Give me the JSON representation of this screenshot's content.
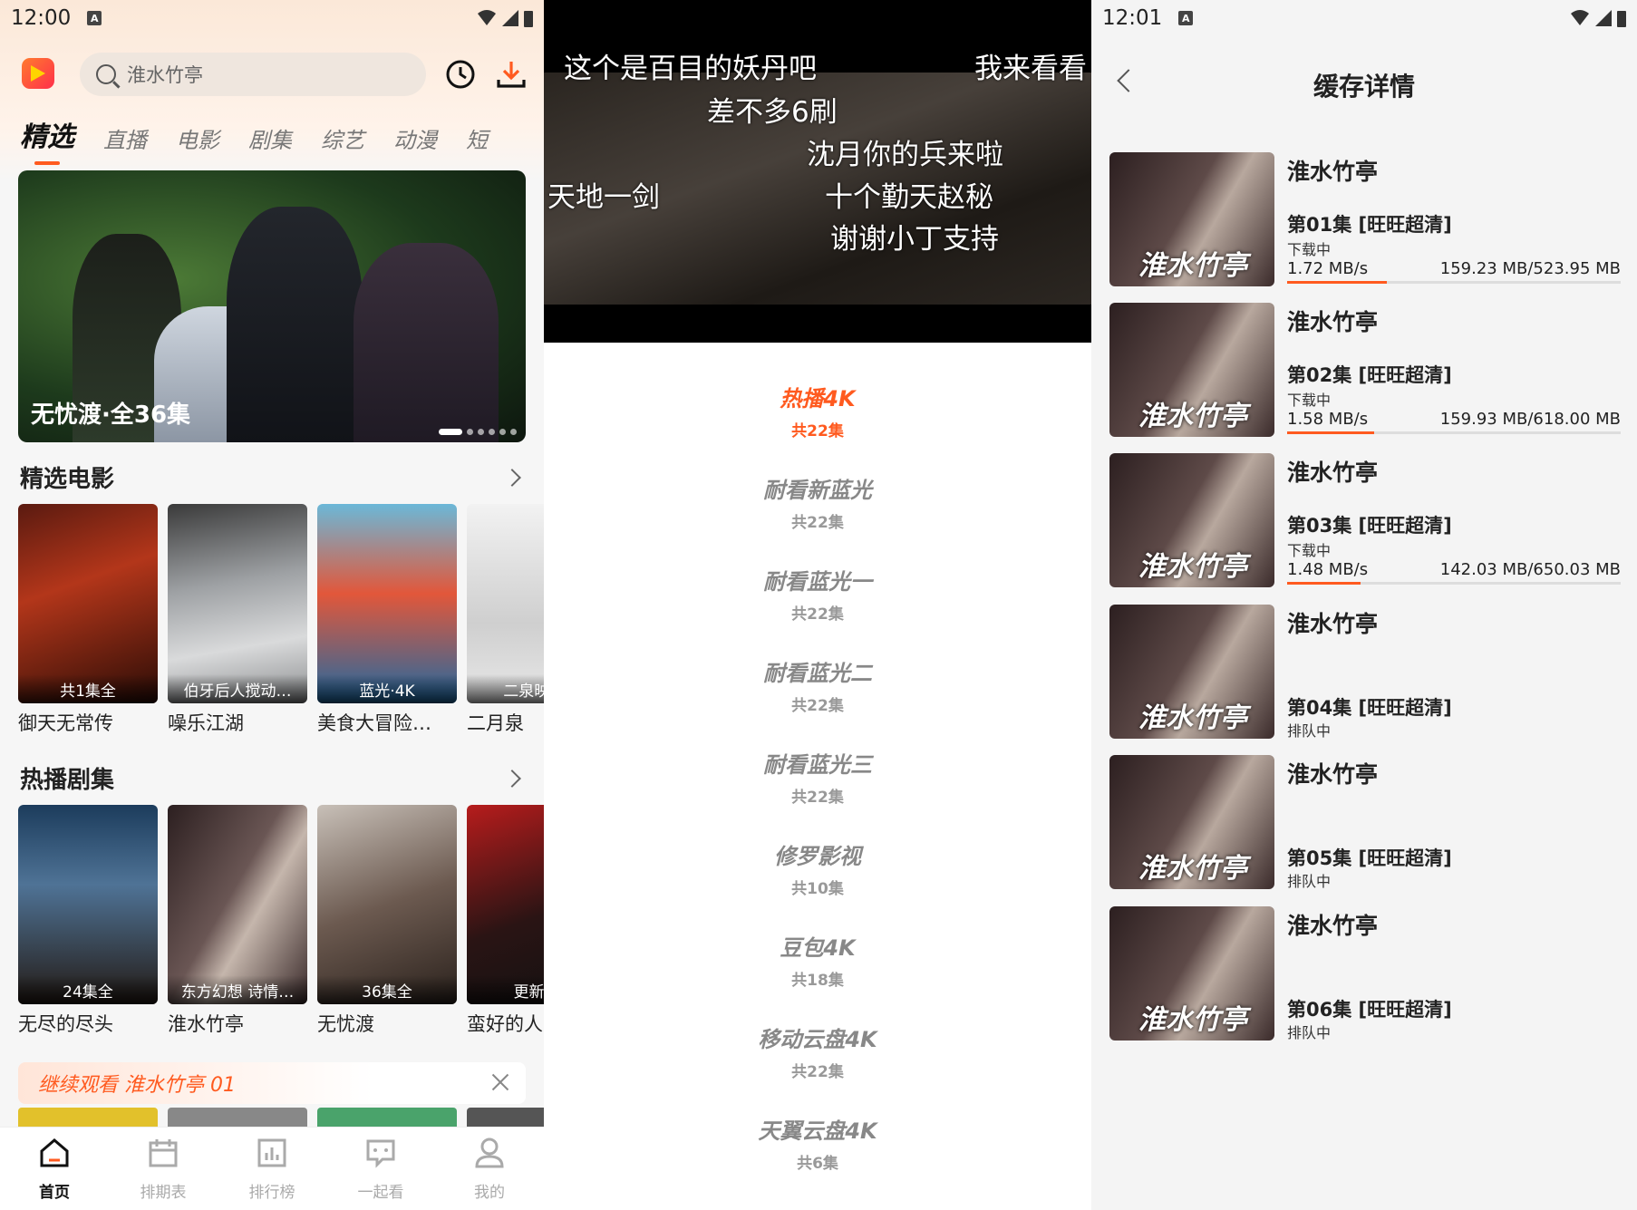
{
  "panel1": {
    "status": {
      "time": "12:00",
      "badge": "A"
    },
    "search": {
      "placeholder": "淮水竹亭"
    },
    "tabs": [
      "精选",
      "直播",
      "电影",
      "剧集",
      "综艺",
      "动漫",
      "短"
    ],
    "banner": {
      "caption": "无忧渡·全36集"
    },
    "section_movies": {
      "title": "精选电影"
    },
    "movies": [
      {
        "badge": "共1集全",
        "title": "御天无常传"
      },
      {
        "badge": "伯牙后人搅动…",
        "title": "噪乐江湖"
      },
      {
        "badge": "蓝光·4K",
        "title": "美食大冒险…"
      },
      {
        "badge": "二泉映月·",
        "title": "二月泉"
      }
    ],
    "section_series": {
      "title": "热播剧集"
    },
    "series": [
      {
        "badge": "24集全",
        "title": "无尽的尽头"
      },
      {
        "badge": "东方幻想 诗情…",
        "title": "淮水竹亭"
      },
      {
        "badge": "36集全",
        "title": "无忧渡"
      },
      {
        "badge": "更新至",
        "title": "蛮好的人"
      }
    ],
    "continue_watch": {
      "text": "继续观看 淮水竹亭 01"
    },
    "nav": [
      {
        "label": "首页",
        "icon": "home-icon"
      },
      {
        "label": "排期表",
        "icon": "calendar-icon"
      },
      {
        "label": "排行榜",
        "icon": "ranking-icon"
      },
      {
        "label": "一起看",
        "icon": "chat-icon"
      },
      {
        "label": "我的",
        "icon": "user-icon"
      }
    ],
    "accent": "#ff5a1f"
  },
  "panel2": {
    "danmaku": [
      "这个是百目的妖丹吧",
      "我来看看",
      "差不多6刷",
      "沈月你的兵来啦",
      "天地一剑",
      "十个勤天赵秘",
      "谢谢小丁支持"
    ],
    "sources": [
      {
        "name": "热播4K",
        "count": "共22集",
        "active": true
      },
      {
        "name": "耐看新蓝光",
        "count": "共22集"
      },
      {
        "name": "耐看蓝光一",
        "count": "共22集"
      },
      {
        "name": "耐看蓝光二",
        "count": "共22集"
      },
      {
        "name": "耐看蓝光三",
        "count": "共22集"
      },
      {
        "name": "修罗影视",
        "count": "共10集"
      },
      {
        "name": "豆包4K",
        "count": "共18集"
      },
      {
        "name": "移动云盘4K",
        "count": "共22集"
      },
      {
        "name": "天翼云盘4K",
        "count": "共6集"
      }
    ]
  },
  "panel3": {
    "status": {
      "time": "12:01",
      "badge": "A"
    },
    "title": "缓存详情",
    "thumb_text": "淮水竹亭",
    "downloads": [
      {
        "title": "淮水竹亭",
        "episode": "第01集 [旺旺超清]",
        "status": "下载中",
        "speed": "1.72 MB/s",
        "size": "159.23 MB/523.95 MB",
        "progress": 0.3
      },
      {
        "title": "淮水竹亭",
        "episode": "第02集 [旺旺超清]",
        "status": "下载中",
        "speed": "1.58 MB/s",
        "size": "159.93 MB/618.00 MB",
        "progress": 0.26
      },
      {
        "title": "淮水竹亭",
        "episode": "第03集 [旺旺超清]",
        "status": "下载中",
        "speed": "1.48 MB/s",
        "size": "142.03 MB/650.03 MB",
        "progress": 0.22
      },
      {
        "title": "淮水竹亭",
        "episode": "第04集 [旺旺超清]",
        "status": "排队中"
      },
      {
        "title": "淮水竹亭",
        "episode": "第05集 [旺旺超清]",
        "status": "排队中"
      },
      {
        "title": "淮水竹亭",
        "episode": "第06集 [旺旺超清]",
        "status": "排队中"
      }
    ]
  }
}
